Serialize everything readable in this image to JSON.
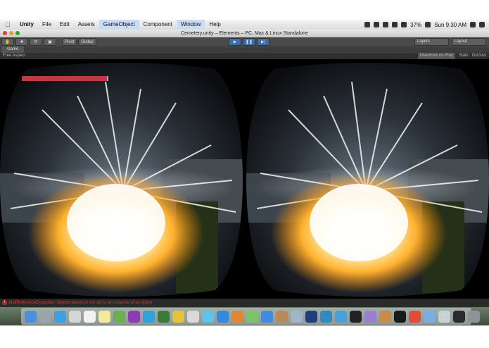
{
  "menubar": {
    "app_name": "Unity",
    "items": [
      "File",
      "Edit",
      "Assets",
      "GameObject",
      "Component",
      "Window",
      "Help"
    ],
    "battery": "37%",
    "clock": "Sun 9:30 AM"
  },
  "window": {
    "title": "Cemetery.unity – Elements – PC, Mac & Linux Standalone"
  },
  "toolbar": {
    "pivot": "Pivot",
    "global": "Global",
    "layers": "Layers",
    "layout": "Layout"
  },
  "game_view": {
    "tab": "Game",
    "aspect": "Free Aspect",
    "maximize": "Maximize on Play",
    "stats": "Stats",
    "gizmos": "Gizmos",
    "health_fraction": 0.98
  },
  "console": {
    "message": "NullReferenceException: Object reference not set to an instance of an object"
  },
  "colors": {
    "health": "#c0394a",
    "play_active": "#3a6ea8",
    "error": "#dd3333"
  },
  "dock_icons": [
    "finder-icon",
    "launchpad-icon",
    "safari-icon",
    "mail-icon",
    "calendar-icon",
    "notes-icon",
    "evernote-icon",
    "onenote-icon",
    "skype-icon",
    "facetime-icon",
    "slides-icon",
    "photos-icon",
    "itunes-icon",
    "appstore-icon",
    "ibooks-icon",
    "maps-icon",
    "xcode-icon",
    "archive-icon",
    "preview-icon",
    "photoshop-icon",
    "sourcetree-icon",
    "globe-icon",
    "unity-icon",
    "utility-icon",
    "guitar-icon",
    "terminal-icon",
    "chrome-icon",
    "folder-icon",
    "files-icon",
    "music-icon",
    "trash-icon"
  ]
}
